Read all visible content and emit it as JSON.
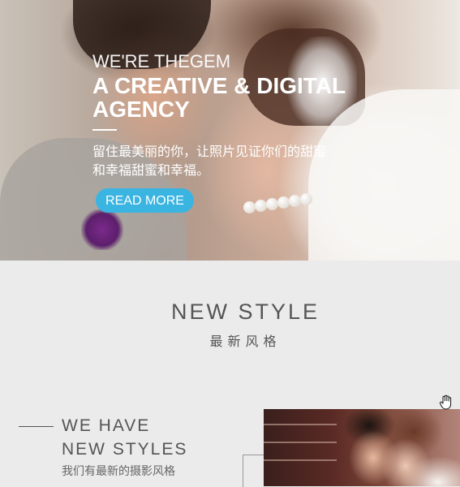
{
  "hero": {
    "tagline": "WE'RE THEGEM",
    "headline": "A CREATIVE & DIGITAL\nAGENCY",
    "description": "留住最美丽的你，让照片见证你们的甜蜜和幸福甜蜜和幸福。",
    "button_label": "READ MORE",
    "button_color": "#3ab4e1"
  },
  "section": {
    "title": "NEW STYLE",
    "subtitle": "最新风格"
  },
  "feature": {
    "title": "WE HAVE\nNEW STYLES",
    "description": "我们有最新的摄影风格"
  },
  "icons": {
    "cursor": "hand-cursor-icon"
  }
}
